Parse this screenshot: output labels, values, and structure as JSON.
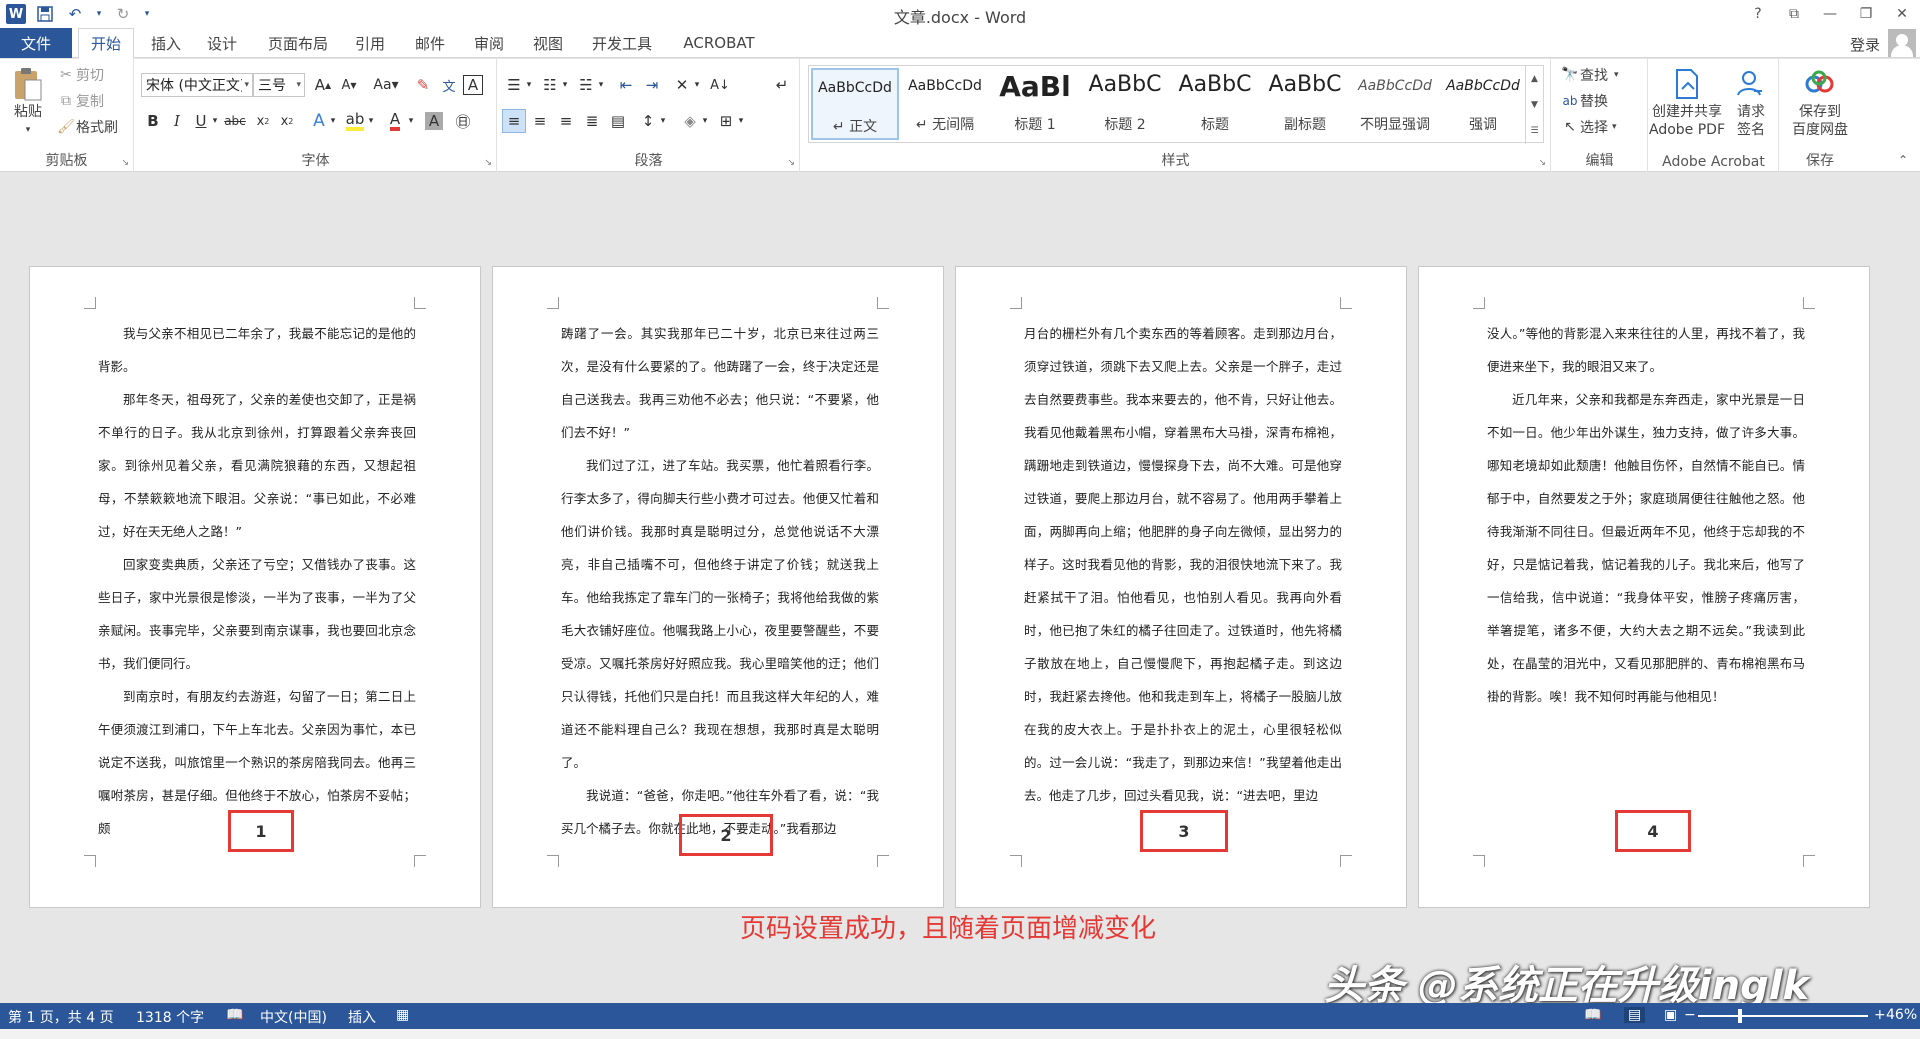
{
  "titlebar": {
    "title": "文章.docx - Word",
    "help": "?",
    "ribbon_display": "⧉",
    "minimize": "—",
    "restore": "❐",
    "close": "✕"
  },
  "tabs": {
    "file": "文件",
    "items": [
      "开始",
      "插入",
      "设计",
      "页面布局",
      "引用",
      "邮件",
      "审阅",
      "视图",
      "开发工具",
      "ACROBAT"
    ],
    "active": "开始",
    "login": "登录"
  },
  "ribbon": {
    "clipboard": {
      "label": "剪贴板",
      "paste": "粘贴",
      "cut": "剪切",
      "copy": "复制",
      "format_painter": "格式刷"
    },
    "font": {
      "label": "字体",
      "font_name": "宋体 (中文正文)",
      "font_size": "三号"
    },
    "paragraph": {
      "label": "段落"
    },
    "styles": {
      "label": "样式",
      "items": [
        {
          "preview": "AaBbCcDd",
          "name": "↵ 正文",
          "selected": true
        },
        {
          "preview": "AaBbCcDd",
          "name": "↵ 无间隔",
          "selected": false
        },
        {
          "preview": "AaBl",
          "name": "标题 1",
          "selected": false
        },
        {
          "preview": "AaBbC",
          "name": "标题 2",
          "selected": false
        },
        {
          "preview": "AaBbC",
          "name": "标题",
          "selected": false
        },
        {
          "preview": "AaBbC",
          "name": "副标题",
          "selected": false
        },
        {
          "preview": "AaBbCcDd",
          "name": "不明显强调",
          "selected": false
        },
        {
          "preview": "AaBbCcDd",
          "name": "强调",
          "selected": false
        }
      ]
    },
    "editing": {
      "label": "编辑",
      "find": "查找",
      "replace": "替换",
      "select": "选择"
    },
    "acrobat": {
      "label": "Adobe Acrobat",
      "create_share_1": "创建并共享",
      "create_share_2": "Adobe PDF",
      "request_sign_1": "请求",
      "request_sign_2": "签名"
    },
    "save": {
      "label": "保存",
      "save_baidu_1": "保存到",
      "save_baidu_2": "百度网盘"
    }
  },
  "pages": [
    {
      "number": "1",
      "paragraphs": [
        "我与父亲不相见已二年余了，我最不能忘记的是他的背影。",
        "那年冬天，祖母死了，父亲的差使也交卸了，正是祸不单行的日子。我从北京到徐州，打算跟着父亲奔丧回家。到徐州见着父亲，看见满院狼藉的东西，又想起祖母，不禁簌簌地流下眼泪。父亲说：“事已如此，不必难过，好在天无绝人之路！”",
        "回家变卖典质，父亲还了亏空；又借钱办了丧事。这些日子，家中光景很是惨淡，一半为了丧事，一半为了父亲赋闲。丧事完毕，父亲要到南京谋事，我也要回北京念书，我们便同行。",
        "到南京时，有朋友约去游逛，勾留了一日；第二日上午便须渡江到浦口，下午上车北去。父亲因为事忙，本已说定不送我，叫旅馆里一个熟识的茶房陪我同去。他再三嘱咐茶房，甚是仔细。但他终于不放心，怕茶房不妥帖；颇"
      ]
    },
    {
      "number": "2",
      "paragraphs": [
        "踌躇了一会。其实我那年已二十岁，北京已来往过两三次，是没有什么要紧的了。他踌躇了一会，终于决定还是自己送我去。我再三劝他不必去；他只说：“不要紧，他们去不好！”",
        "我们过了江，进了车站。我买票，他忙着照看行李。行李太多了，得向脚夫行些小费才可过去。他便又忙着和他们讲价钱。我那时真是聪明过分，总觉他说话不大漂亮，非自己插嘴不可，但他终于讲定了价钱；就送我上车。他给我拣定了靠车门的一张椅子；我将他给我做的紫毛大衣铺好座位。他嘱我路上小心，夜里要警醒些，不要受凉。又嘱托茶房好好照应我。我心里暗笑他的迂；他们只认得钱，托他们只是白托！而且我这样大年纪的人，难道还不能料理自己么？我现在想想，我那时真是太聪明了。",
        "我说道：“爸爸，你走吧。”他往车外看了看，说：“我买几个橘子去。你就在此地，不要走动。”我看那边"
      ]
    },
    {
      "number": "3",
      "paragraphs": [
        "月台的栅栏外有几个卖东西的等着顾客。走到那边月台，须穿过铁道，须跳下去又爬上去。父亲是一个胖子，走过去自然要费事些。我本来要去的，他不肯，只好让他去。我看见他戴着黑布小帽，穿着黑布大马褂，深青布棉袍，蹒跚地走到铁道边，慢慢探身下去，尚不大难。可是他穿过铁道，要爬上那边月台，就不容易了。他用两手攀着上面，两脚再向上缩；他肥胖的身子向左微倾，显出努力的样子。这时我看见他的背影，我的泪很快地流下来了。我赶紧拭干了泪。怕他看见，也怕别人看见。我再向外看时，他已抱了朱红的橘子往回走了。过铁道时，他先将橘子散放在地上，自己慢慢爬下，再抱起橘子走。到这边时，我赶紧去搀他。他和我走到车上，将橘子一股脑儿放在我的皮大衣上。于是扑扑衣上的泥土，心里很轻松似的。过一会儿说：“我走了，到那边来信！”我望着他走出去。他走了几步，回过头看见我，说：“进去吧，里边"
      ]
    },
    {
      "number": "4",
      "paragraphs": [
        "没人。”等他的背影混入来来往往的人里，再找不着了，我便进来坐下，我的眼泪又来了。",
        "近几年来，父亲和我都是东奔西走，家中光景是一日不如一日。他少年出外谋生，独力支持，做了许多大事。哪知老境却如此颓唐！他触目伤怀，自然情不能自已。情郁于中，自然要发之于外；家庭琐屑便往往触他之怒。他待我渐渐不同往日。但最近两年不见，他终于忘却我的不好，只是惦记着我，惦记着我的儿子。我北来后，他写了一信给我，信中说道：“我身体平安，惟膀子疼痛厉害，举箸提笔，诸多不便，大约大去之期不远矣。”我读到此处，在晶莹的泪光中，又看见那肥胖的、青布棉袍黑布马褂的背影。唉！我不知何时再能与他相见！"
      ]
    }
  ],
  "annotation": "页码设置成功，且随着页面增减变化",
  "watermark": "头条 @系统正在升级inglk",
  "statusbar": {
    "page": "第 1 页，共 4 页",
    "words": "1318 个字",
    "language": "中文(中国)",
    "mode": "插入",
    "zoom": "46%"
  },
  "colors": {
    "accent": "#2b579a",
    "highlight_red": "#e53935"
  }
}
